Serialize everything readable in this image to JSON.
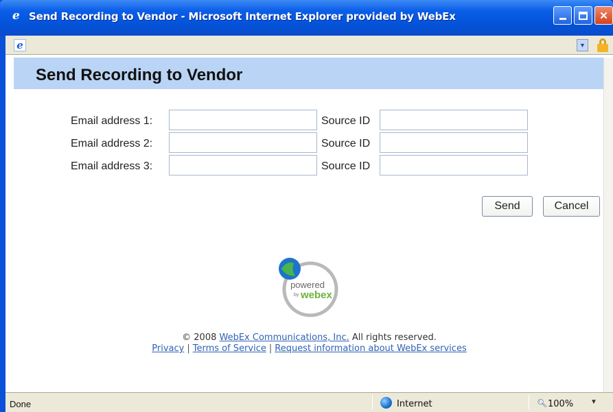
{
  "window": {
    "title": "Send Recording to Vendor - Microsoft Internet Explorer provided by WebEx",
    "icon": "ie-icon",
    "controls": {
      "minimize": "minimize-icon",
      "maximize": "maximize-icon",
      "close": "close-icon"
    }
  },
  "addressbar": {
    "icon": "ie-page-icon",
    "dropdown_icon": "chevron-down-icon",
    "security_icon": "lock-icon"
  },
  "page": {
    "title": "Send Recording to Vendor",
    "rows": [
      {
        "email_label": "Email address 1:",
        "email_value": "",
        "source_label": "Source ID",
        "source_value": ""
      },
      {
        "email_label": "Email address 2:",
        "email_value": "",
        "source_label": "Source ID",
        "source_value": ""
      },
      {
        "email_label": "Email address 3:",
        "email_value": "",
        "source_label": "Source ID",
        "source_value": ""
      }
    ],
    "buttons": {
      "send": "Send",
      "cancel": "Cancel"
    },
    "logo": {
      "line1": "powered",
      "line2": "by",
      "line3": "webex"
    },
    "footer": {
      "copyright_prefix": "© 2008",
      "company_link": "WebEx Communications, Inc.",
      "copyright_suffix": "All rights reserved.",
      "links": [
        "Privacy",
        "Terms of Service",
        "Request information about WebEx services"
      ],
      "separator": "|"
    }
  },
  "statusbar": {
    "status": "Done",
    "zone": "Internet",
    "zoom": "100%"
  },
  "colors": {
    "titlebar": "#0452d8",
    "header_band": "#b9d4f4",
    "link": "#2f62b5",
    "chrome": "#ece9d8"
  }
}
